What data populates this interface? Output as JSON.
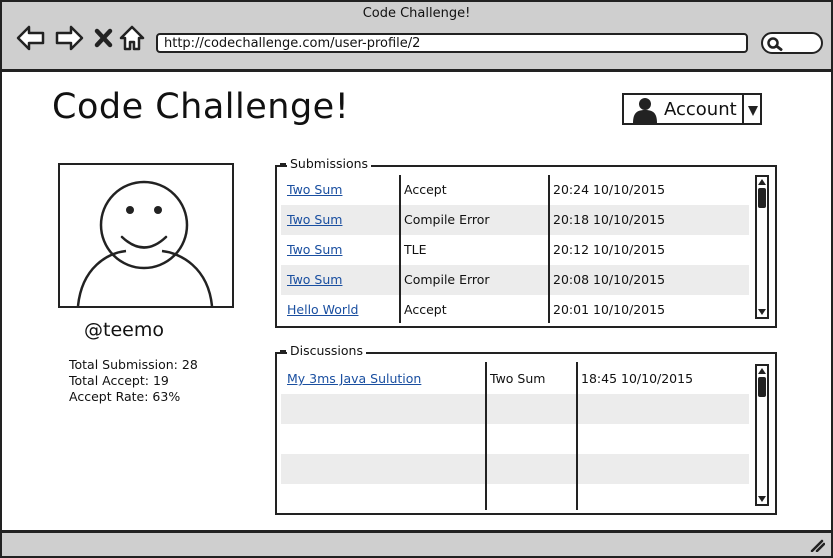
{
  "browser": {
    "window_title": "Code Challenge!",
    "url": "http://codechallenge.com/user-profile/2"
  },
  "header": {
    "title": "Code Challenge!",
    "account_label": "Account"
  },
  "profile": {
    "handle": "@teemo",
    "total_submission": "Total Submission: 28",
    "total_accept": "Total Accept: 19",
    "accept_rate": "Accept Rate: 63%"
  },
  "submissions": {
    "title": "Submissions",
    "rows": [
      {
        "problem": "Two Sum",
        "status": "Accept",
        "time": "20:24 10/10/2015"
      },
      {
        "problem": "Two Sum",
        "status": "Compile Error",
        "time": "20:18 10/10/2015"
      },
      {
        "problem": "Two Sum",
        "status": "TLE",
        "time": "20:12 10/10/2015"
      },
      {
        "problem": "Two Sum",
        "status": "Compile Error",
        "time": "20:08 10/10/2015"
      },
      {
        "problem": "Hello World",
        "status": "Accept",
        "time": "20:01 10/10/2015"
      }
    ]
  },
  "discussions": {
    "title": "Discussions",
    "rows": [
      {
        "topic": "My 3ms Java Sulution",
        "problem": "Two Sum",
        "time": "18:45 10/10/2015"
      },
      {
        "topic": "",
        "problem": "",
        "time": ""
      },
      {
        "topic": "",
        "problem": "",
        "time": ""
      },
      {
        "topic": "",
        "problem": "",
        "time": ""
      }
    ]
  },
  "icons": {
    "back": "back-arrow-icon",
    "forward": "forward-arrow-icon",
    "stop": "close-icon",
    "home": "home-icon",
    "search": "search-icon",
    "account": "user-icon",
    "dropdown": "caret-down-icon",
    "resize": "resize-grip-icon"
  }
}
